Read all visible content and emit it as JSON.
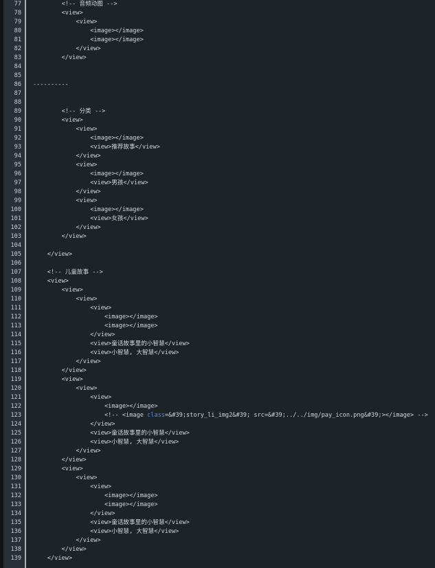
{
  "lines": [
    {
      "num": "77",
      "indent": 2,
      "text": "<!-- 音频动图 -->"
    },
    {
      "num": "78",
      "indent": 2,
      "text": "<view>"
    },
    {
      "num": "79",
      "indent": 3,
      "text": "<view>"
    },
    {
      "num": "80",
      "indent": 4,
      "text": "<image></image>"
    },
    {
      "num": "81",
      "indent": 4,
      "text": "<image></image>"
    },
    {
      "num": "82",
      "indent": 3,
      "text": "</view>"
    },
    {
      "num": "83",
      "indent": 2,
      "text": "</view>"
    },
    {
      "num": "84",
      "indent": 0,
      "text": ""
    },
    {
      "num": "85",
      "indent": 0,
      "text": ""
    },
    {
      "num": "86",
      "indent": 0,
      "text": "----------"
    },
    {
      "num": "87",
      "indent": 0,
      "text": ""
    },
    {
      "num": "88",
      "indent": 0,
      "text": ""
    },
    {
      "num": "89",
      "indent": 2,
      "text": "<!-- 分类 -->"
    },
    {
      "num": "90",
      "indent": 2,
      "text": "<view>"
    },
    {
      "num": "91",
      "indent": 3,
      "text": "<view>"
    },
    {
      "num": "92",
      "indent": 4,
      "text": "<image></image>"
    },
    {
      "num": "93",
      "indent": 4,
      "text": "<view>推荐故事</view>"
    },
    {
      "num": "94",
      "indent": 3,
      "text": "</view>"
    },
    {
      "num": "95",
      "indent": 3,
      "text": "<view>"
    },
    {
      "num": "96",
      "indent": 4,
      "text": "<image></image>"
    },
    {
      "num": "97",
      "indent": 4,
      "text": "<view>男孩</view>"
    },
    {
      "num": "98",
      "indent": 3,
      "text": "</view>"
    },
    {
      "num": "99",
      "indent": 3,
      "text": "<view>"
    },
    {
      "num": "100",
      "indent": 4,
      "text": "<image></image>"
    },
    {
      "num": "101",
      "indent": 4,
      "text": "<view>女孩</view>"
    },
    {
      "num": "102",
      "indent": 3,
      "text": "</view>"
    },
    {
      "num": "103",
      "indent": 2,
      "text": "</view>"
    },
    {
      "num": "104",
      "indent": 0,
      "text": ""
    },
    {
      "num": "105",
      "indent": 1,
      "text": "</view>"
    },
    {
      "num": "106",
      "indent": 0,
      "text": ""
    },
    {
      "num": "107",
      "indent": 1,
      "text": "<!-- 儿童故事 -->"
    },
    {
      "num": "108",
      "indent": 1,
      "text": "<view>"
    },
    {
      "num": "109",
      "indent": 2,
      "text": "<view>"
    },
    {
      "num": "110",
      "indent": 3,
      "text": "<view>"
    },
    {
      "num": "111",
      "indent": 4,
      "text": "<view>"
    },
    {
      "num": "112",
      "indent": 5,
      "text": "<image></image>"
    },
    {
      "num": "113",
      "indent": 5,
      "text": "<image></image>"
    },
    {
      "num": "114",
      "indent": 4,
      "text": "</view>"
    },
    {
      "num": "115",
      "indent": 4,
      "text": "<view>童话故事里的小智慧</view>"
    },
    {
      "num": "116",
      "indent": 4,
      "text": "<view>小智慧, 大智慧</view>"
    },
    {
      "num": "117",
      "indent": 3,
      "text": "</view>"
    },
    {
      "num": "118",
      "indent": 2,
      "text": "</view>"
    },
    {
      "num": "119",
      "indent": 2,
      "text": "<view>"
    },
    {
      "num": "120",
      "indent": 3,
      "text": "<view>"
    },
    {
      "num": "121",
      "indent": 4,
      "text": "<view>"
    },
    {
      "num": "122",
      "indent": 5,
      "text": "<image></image>"
    },
    {
      "num": "123",
      "indent": 5,
      "pre": "<!-- <image ",
      "kw": "class",
      "post": "=&#39;story_li_img2&#39; src=&#39;../../img/pay_icon.png&#39;></image> -->"
    },
    {
      "num": "124",
      "indent": 4,
      "text": "</view>"
    },
    {
      "num": "125",
      "indent": 4,
      "text": "<view>童话故事里的小智慧</view>"
    },
    {
      "num": "126",
      "indent": 4,
      "text": "<view>小智慧, 大智慧</view>"
    },
    {
      "num": "127",
      "indent": 3,
      "text": "</view>"
    },
    {
      "num": "128",
      "indent": 2,
      "text": "</view>"
    },
    {
      "num": "129",
      "indent": 2,
      "text": "<view>"
    },
    {
      "num": "130",
      "indent": 3,
      "text": "<view>"
    },
    {
      "num": "131",
      "indent": 4,
      "text": "<view>"
    },
    {
      "num": "132",
      "indent": 5,
      "text": "<image></image>"
    },
    {
      "num": "133",
      "indent": 5,
      "text": "<image></image>"
    },
    {
      "num": "134",
      "indent": 4,
      "text": "</view>"
    },
    {
      "num": "135",
      "indent": 4,
      "text": "<view>童话故事里的小智慧</view>"
    },
    {
      "num": "136",
      "indent": 4,
      "text": "<view>小智慧, 大智慧</view>"
    },
    {
      "num": "137",
      "indent": 3,
      "text": "</view>"
    },
    {
      "num": "138",
      "indent": 2,
      "text": "</view>"
    },
    {
      "num": "139",
      "indent": 1,
      "text": "</view>"
    }
  ]
}
